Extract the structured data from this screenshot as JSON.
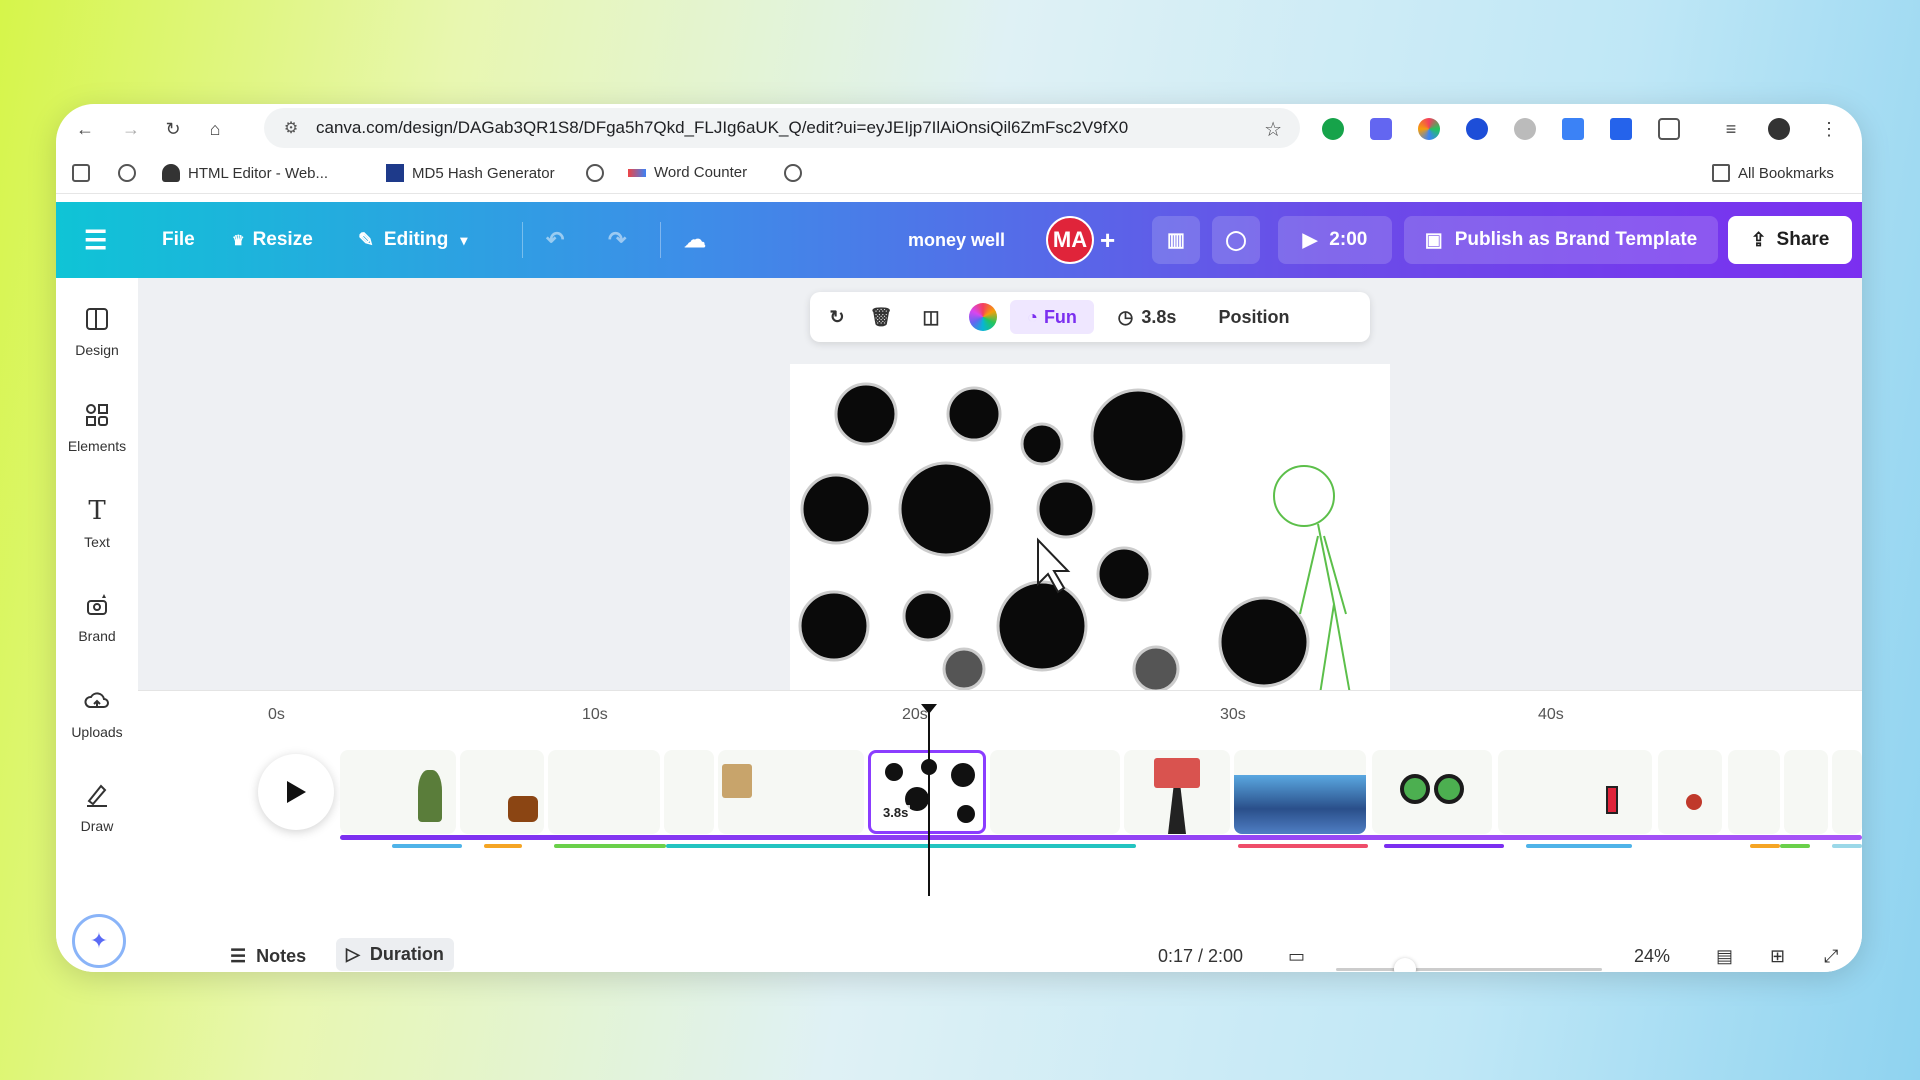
{
  "browser": {
    "url": "canva.com/design/DAGab3QR1S8/DFga5h7Qkd_FLJIg6aUK_Q/edit?ui=eyJEIjp7IlAiOnsiQil6ZmFsc2V9fX0",
    "bookmarks": [
      "HTML Editor - Web...",
      "MD5 Hash Generator",
      "Word Counter"
    ],
    "all_bookmarks": "All Bookmarks"
  },
  "header": {
    "file": "File",
    "resize": "Resize",
    "editing": "Editing",
    "design_name": "money well",
    "avatar_initials": "MA",
    "present_time": "2:00",
    "publish": "Publish as Brand Template",
    "share": "Share"
  },
  "sidebar": {
    "items": [
      {
        "label": "Design",
        "icon": "design-icon"
      },
      {
        "label": "Elements",
        "icon": "elements-icon"
      },
      {
        "label": "Text",
        "icon": "text-icon"
      },
      {
        "label": "Brand",
        "icon": "brand-icon"
      },
      {
        "label": "Uploads",
        "icon": "uploads-icon"
      },
      {
        "label": "Draw",
        "icon": "draw-icon"
      }
    ]
  },
  "context_toolbar": {
    "animation": "Fun",
    "duration": "3.8s",
    "position": "Position"
  },
  "timeline": {
    "ruler": [
      "0s",
      "10s",
      "20s",
      "30s",
      "40s"
    ],
    "selected_clip_duration": "3.8s",
    "time_display": "0:17 / 2:00",
    "zoom": "24%",
    "notes": "Notes",
    "duration": "Duration"
  },
  "colors": {
    "accent_purple": "#8b3dff",
    "avatar_red": "#e0243a"
  }
}
